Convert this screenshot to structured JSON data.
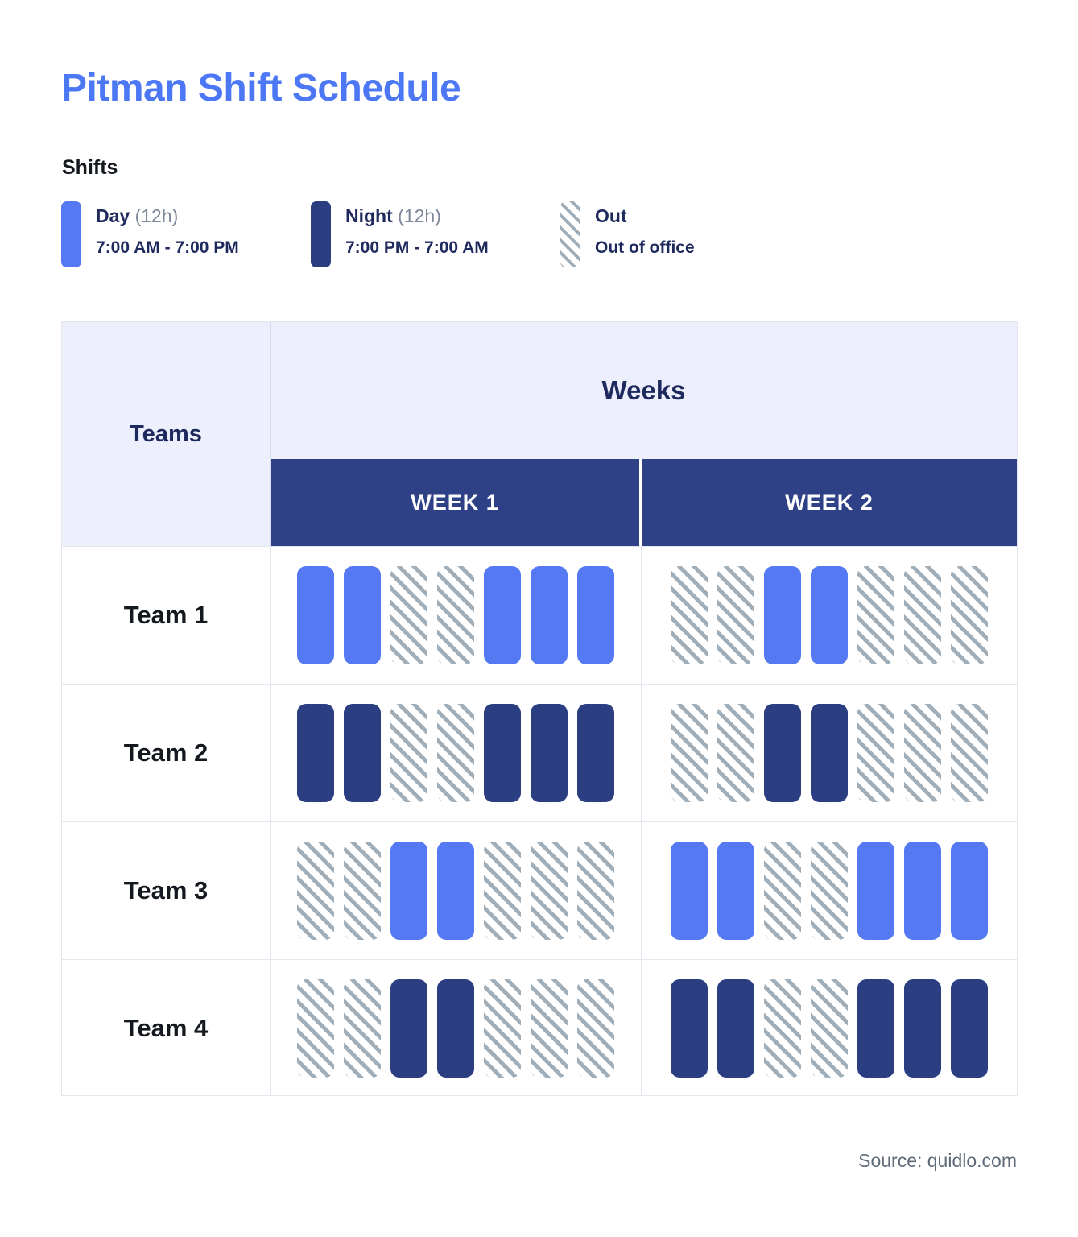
{
  "title": "Pitman Shift Schedule",
  "legend": {
    "heading": "Shifts",
    "items": [
      {
        "key": "day",
        "label": "Day",
        "duration": "(12h)",
        "time": "7:00 AM - 7:00 PM",
        "color": "#5579F2"
      },
      {
        "key": "night",
        "label": "Night",
        "duration": "(12h)",
        "time": "7:00 PM - 7:00 AM",
        "color": "#2B3E82"
      },
      {
        "key": "out",
        "label": "Out",
        "duration": "",
        "time": "Out of office",
        "color": "#9FAEB8"
      }
    ]
  },
  "table": {
    "teams_header": "Teams",
    "weeks_header": "Weeks",
    "week_headers": [
      "WEEK 1",
      "WEEK 2"
    ],
    "rows": [
      {
        "team": "Team 1",
        "week1": [
          "day",
          "day",
          "out",
          "out",
          "day",
          "day",
          "day"
        ],
        "week2": [
          "out",
          "out",
          "day",
          "day",
          "out",
          "out",
          "out"
        ]
      },
      {
        "team": "Team 2",
        "week1": [
          "night",
          "night",
          "out",
          "out",
          "night",
          "night",
          "night"
        ],
        "week2": [
          "out",
          "out",
          "night",
          "night",
          "out",
          "out",
          "out"
        ]
      },
      {
        "team": "Team 3",
        "week1": [
          "out",
          "out",
          "day",
          "day",
          "out",
          "out",
          "out"
        ],
        "week2": [
          "day",
          "day",
          "out",
          "out",
          "day",
          "day",
          "day"
        ]
      },
      {
        "team": "Team 4",
        "week1": [
          "out",
          "out",
          "night",
          "night",
          "out",
          "out",
          "out"
        ],
        "week2": [
          "night",
          "night",
          "out",
          "out",
          "night",
          "night",
          "night"
        ]
      }
    ]
  },
  "source": "Source: quidlo.com",
  "chart_data": {
    "type": "table",
    "title": "Pitman Shift Schedule",
    "categories": [
      "WEEK 1",
      "WEEK 2"
    ],
    "days_per_week": 7,
    "legend": [
      "Day (12h) 7:00 AM - 7:00 PM",
      "Night (12h) 7:00 PM - 7:00 AM",
      "Out — Out of office"
    ],
    "series": [
      {
        "name": "Team 1",
        "values": [
          "day",
          "day",
          "out",
          "out",
          "day",
          "day",
          "day",
          "out",
          "out",
          "day",
          "day",
          "out",
          "out",
          "out"
        ]
      },
      {
        "name": "Team 2",
        "values": [
          "night",
          "night",
          "out",
          "out",
          "night",
          "night",
          "night",
          "out",
          "out",
          "night",
          "night",
          "out",
          "out",
          "out"
        ]
      },
      {
        "name": "Team 3",
        "values": [
          "out",
          "out",
          "day",
          "day",
          "out",
          "out",
          "out",
          "day",
          "day",
          "out",
          "out",
          "day",
          "day",
          "day"
        ]
      },
      {
        "name": "Team 4",
        "values": [
          "out",
          "out",
          "night",
          "night",
          "out",
          "out",
          "out",
          "night",
          "night",
          "out",
          "out",
          "night",
          "night",
          "night"
        ]
      }
    ]
  }
}
